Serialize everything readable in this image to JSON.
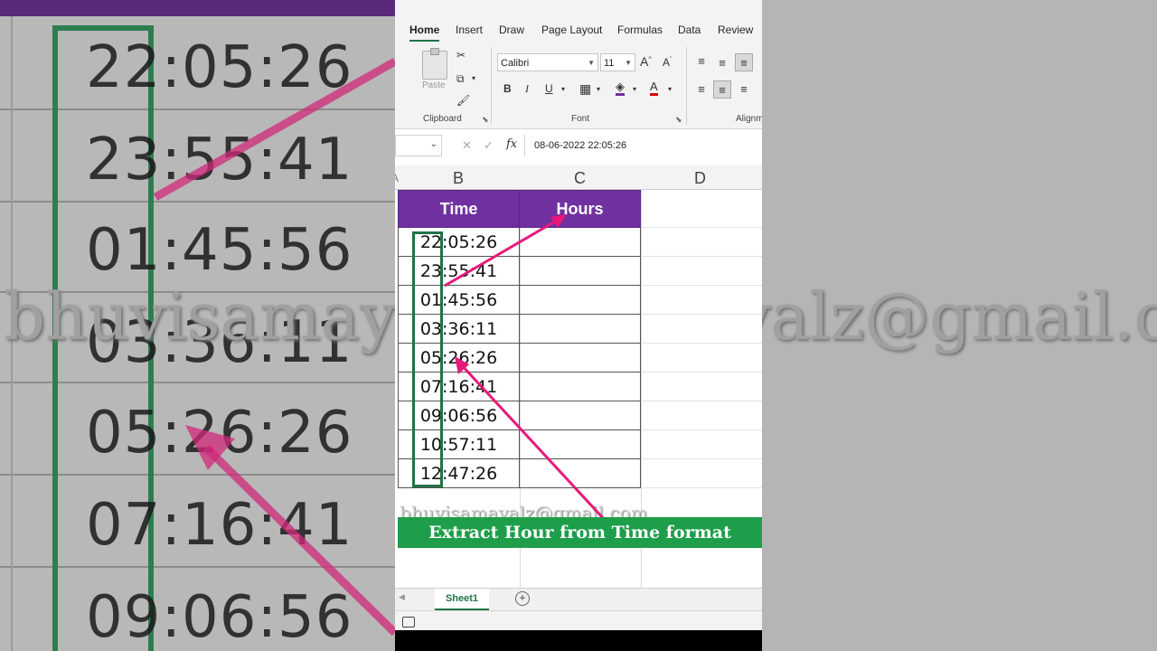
{
  "backdrop": {
    "times": [
      "22:05:26",
      "23:55:41",
      "01:45:56",
      "03:36:11",
      "05:26:26",
      "07:16:41",
      "09:06:56"
    ],
    "watermark": "bhuvisamayalz@gmail.com"
  },
  "ribbon": {
    "tabs": [
      "Home",
      "Insert",
      "Draw",
      "Page Layout",
      "Formulas",
      "Data",
      "Review"
    ],
    "active_tab": "Home",
    "clipboard": {
      "paste_label": "Paste",
      "group_label": "Clipboard"
    },
    "font": {
      "name": "Calibri",
      "size": "11",
      "group_label": "Font",
      "bold": "B",
      "italic": "I",
      "underline": "U",
      "grow": "A",
      "shrink": "A"
    },
    "alignment": {
      "group_label": "Alignm"
    }
  },
  "formula_bar": {
    "content": "08-06-2022  22:05:26",
    "fx_label": "fx",
    "cancel": "✕",
    "enter": "✓"
  },
  "columns": [
    "B",
    "C",
    "D"
  ],
  "table": {
    "headers": [
      "Time",
      "Hours"
    ],
    "rows": [
      "22:05:26",
      "23:55:41",
      "01:45:56",
      "03:36:11",
      "05:26:26",
      "07:16:41",
      "09:06:56",
      "10:57:11",
      "12:47:26"
    ]
  },
  "banner": "Extract Hour from Time format",
  "watermark": "bhuvisamayalz@gmail.com",
  "sheet_tabs": {
    "active": "Sheet1",
    "add": "+"
  },
  "colors": {
    "header_purple": "#7030a0",
    "banner_green": "#1e9e4a",
    "excel_green": "#217346",
    "arrow_pink": "#e8197a"
  }
}
